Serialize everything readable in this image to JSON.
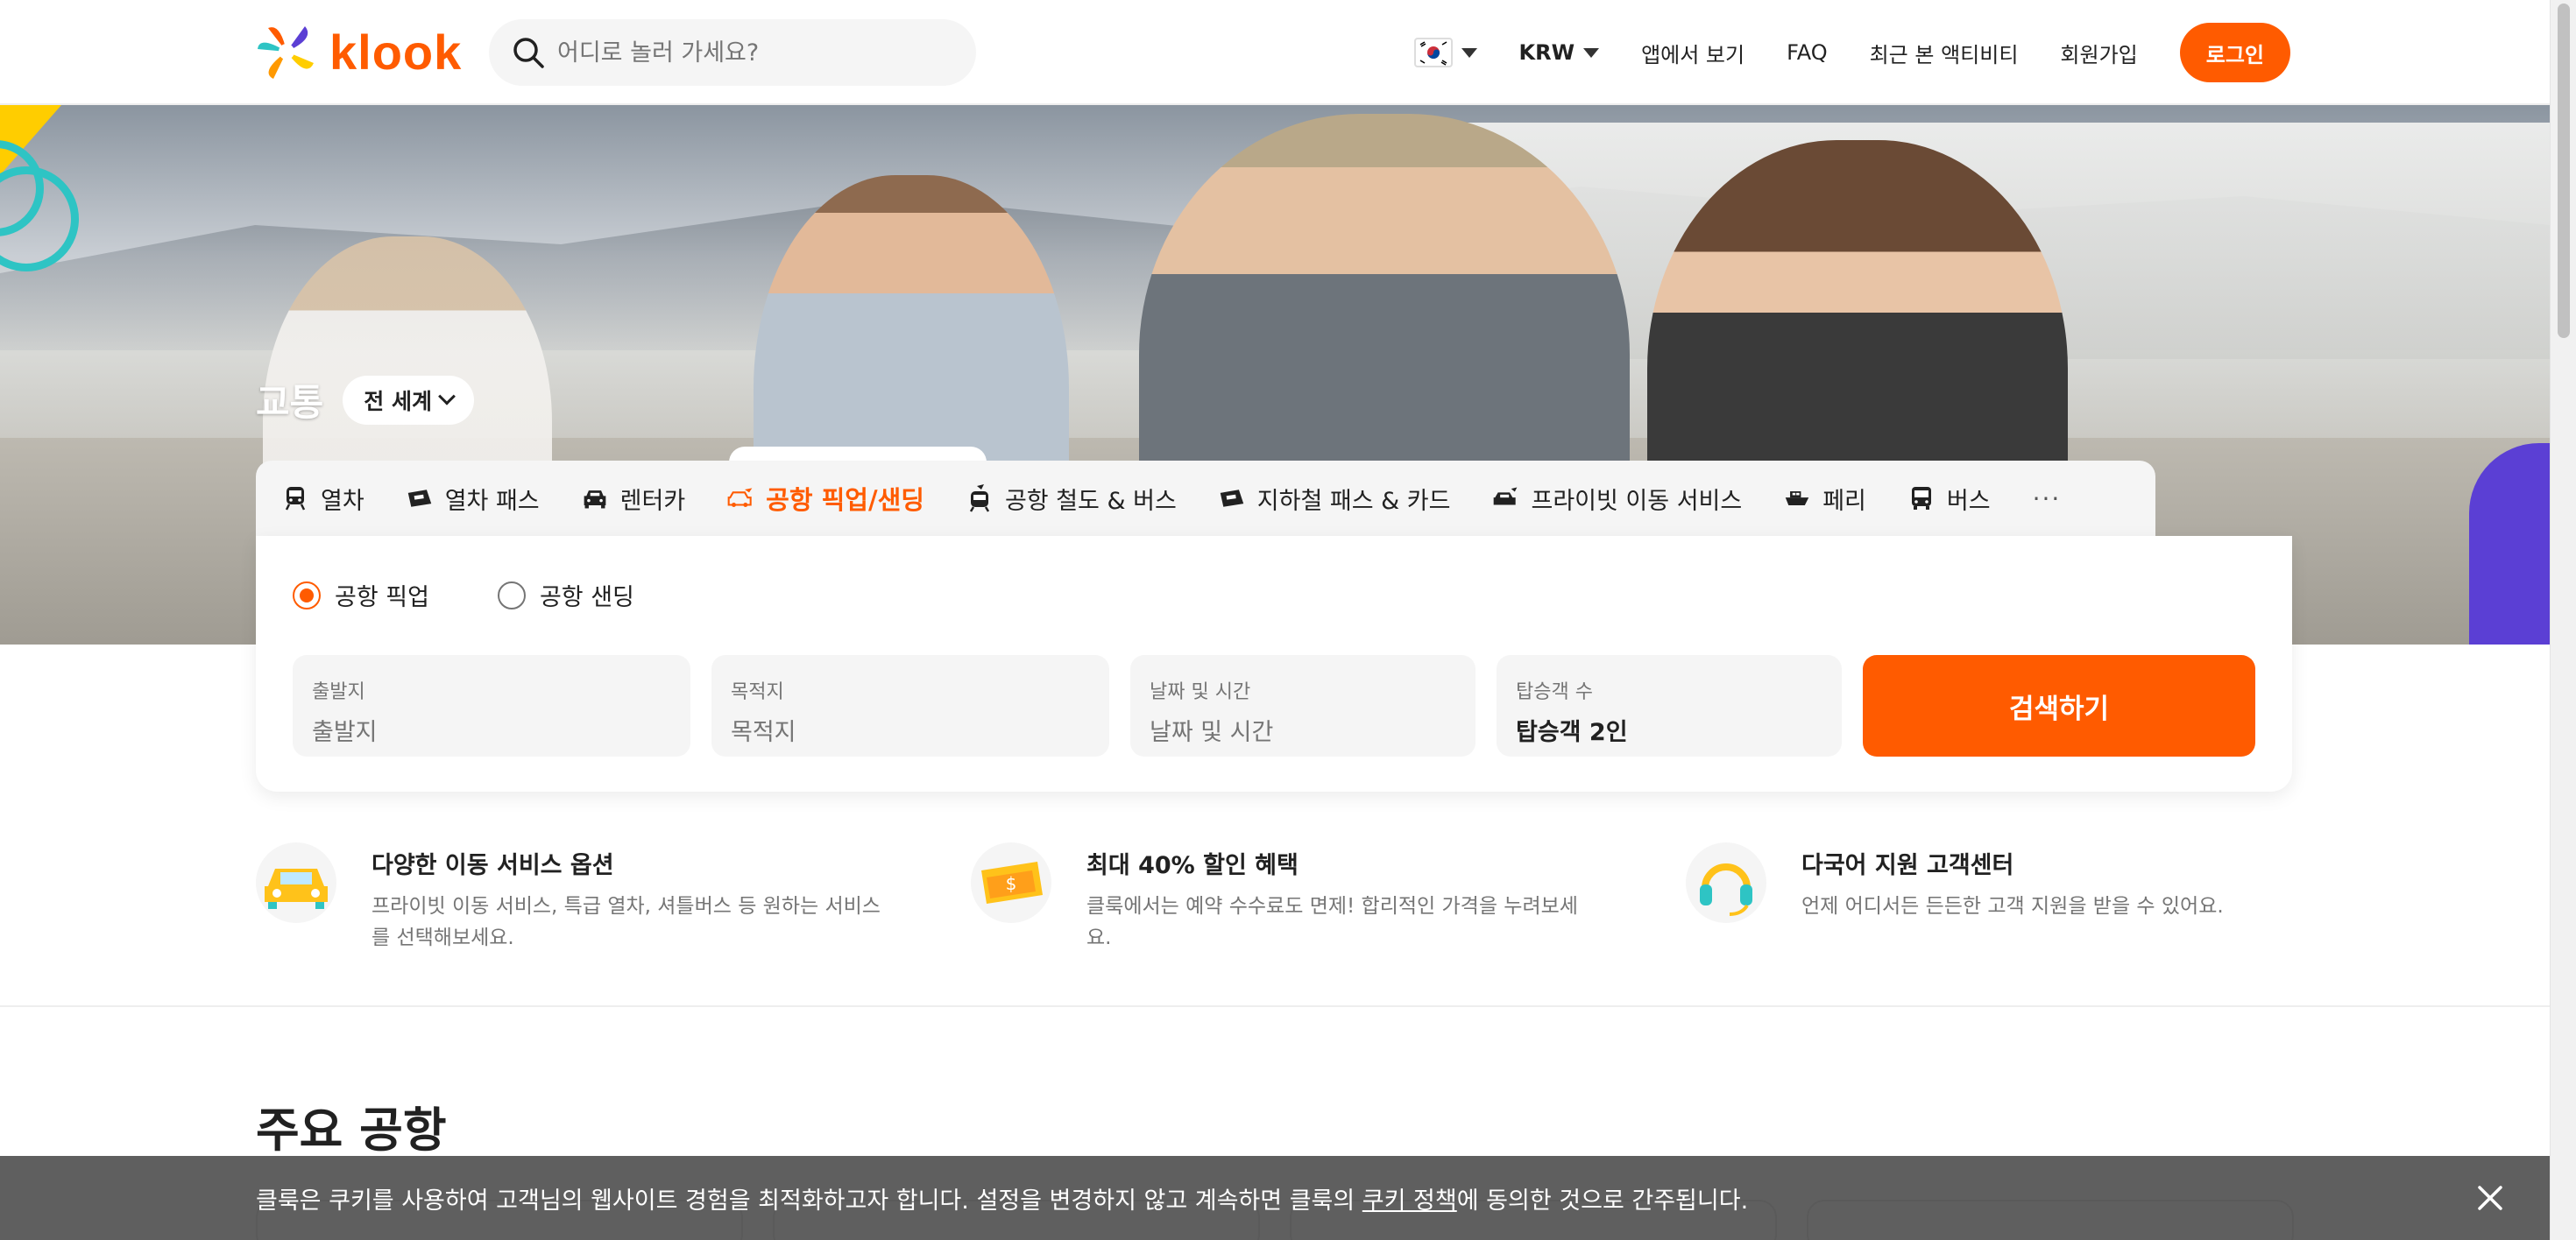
{
  "header": {
    "logo_text": "klook",
    "search_placeholder": "어디로 놀러 가세요?",
    "currency": "KRW",
    "nav": [
      "앱에서 보기",
      "FAQ",
      "최근 본 액티비티",
      "회원가입"
    ],
    "login_label": "로그인"
  },
  "hero": {
    "title": "교통",
    "region_label": "전 세계"
  },
  "tabs": [
    {
      "label": "열차",
      "icon": "train-icon"
    },
    {
      "label": "열차 패스",
      "icon": "rail-pass-icon"
    },
    {
      "label": "렌터카",
      "icon": "car-icon"
    },
    {
      "label": "공항 픽업/샌딩",
      "icon": "airport-car-icon",
      "active": true
    },
    {
      "label": "공항 철도 & 버스",
      "icon": "airport-rail-icon"
    },
    {
      "label": "지하철 패스 & 카드",
      "icon": "subway-card-icon"
    },
    {
      "label": "프라이빗 이동 서비스",
      "icon": "private-car-icon"
    },
    {
      "label": "페리",
      "icon": "ferry-icon"
    },
    {
      "label": "버스",
      "icon": "bus-icon"
    },
    {
      "label": "···",
      "icon": "more-icon"
    }
  ],
  "search": {
    "radios": [
      {
        "label": "공항 픽업",
        "checked": true
      },
      {
        "label": "공항 샌딩",
        "checked": false
      }
    ],
    "fields": [
      {
        "label": "출발지",
        "value": "출발지"
      },
      {
        "label": "목적지",
        "value": "목적지"
      },
      {
        "label": "날짜 및 시간",
        "value": "날짜 및 시간"
      },
      {
        "label": "탑승객 수",
        "value": "탑승객 2인"
      }
    ],
    "submit_label": "검색하기"
  },
  "features": [
    {
      "title": "다양한 이동 서비스 옵션",
      "desc_line1": "프라이빗 이동 서비스, 특급 열차, 셔틀버스 등 원하는 서비스",
      "desc_line2": "를 선택해보세요.",
      "icon": "yellow-car-icon"
    },
    {
      "title": "최대 40% 할인 혜택",
      "desc_line1": "클룩에서는 예약 수수료도 면제! 합리적인 가격을 누려보세",
      "desc_line2": "요.",
      "icon": "dollar-ticket-icon"
    },
    {
      "title": "다국어 지원 고객센터",
      "desc_line1": "언제 어디서든 든든한 고객 지원을 받을 수 있어요.",
      "desc_line2": "",
      "icon": "headset-icon"
    }
  ],
  "section": {
    "title": "주요 공항"
  },
  "cookie": {
    "text_before": "클룩은 쿠키를 사용하여 고객님의 웹사이트 경험을 최적화하고자 합니다. 설정을 변경하지 않고 계속하면 클룩의 ",
    "link": "쿠키 정책",
    "text_after": "에 동의한 것으로 간주됩니다."
  },
  "colors": {
    "brand": "#ff5b00",
    "accent_teal": "#2ec4c4",
    "accent_purple": "#5b3fd4",
    "accent_yellow": "#ffcd00"
  }
}
